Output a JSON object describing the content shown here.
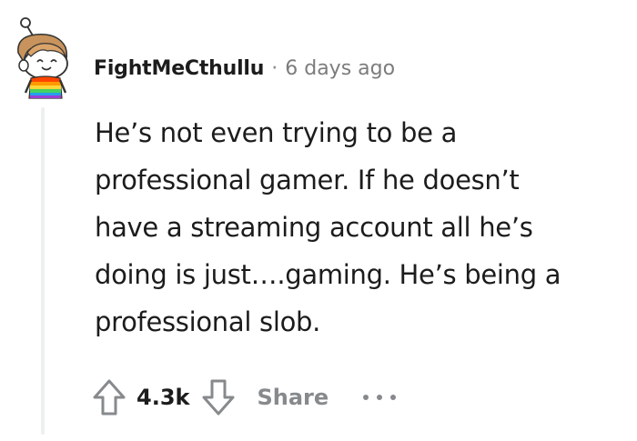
{
  "comment": {
    "username": "FightMeCthullu",
    "separator": "·",
    "timestamp": "6 days ago",
    "body_lines": [
      "He’s not even trying to be a",
      "professional gamer. If he doesn’t",
      "have a streaming account all he’s",
      "doing is just….gaming. He’s being a",
      "professional slob."
    ],
    "score": "4.3k",
    "share_label": "Share"
  },
  "icons": {
    "avatar": "snoo-avatar-icon",
    "upvote": "upvote-arrow-icon",
    "downvote": "downvote-arrow-icon",
    "more": "more-options-icon"
  },
  "colors": {
    "text": "#1c1c1c",
    "muted": "#878a8c",
    "thread_line": "#edeff1"
  }
}
